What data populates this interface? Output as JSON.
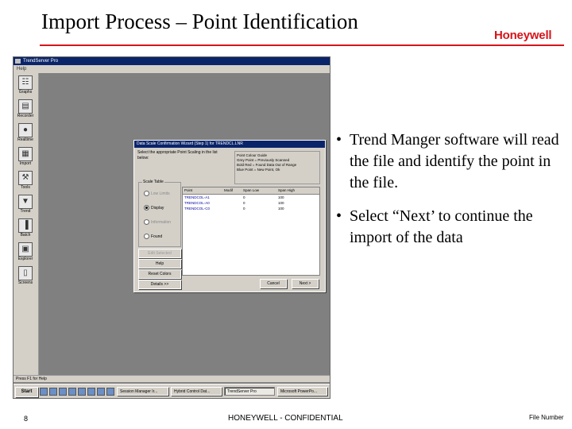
{
  "slide": {
    "title": "Import Process – Point Identification",
    "brand": "Honeywell",
    "page_number": "8",
    "confidential": "HONEYWELL - CONFIDENTIAL",
    "file_number": "File Number"
  },
  "bullets": [
    {
      "mark": "•",
      "text": "Trend Manger software will read the file and identify the point in the file."
    },
    {
      "mark": "•",
      "text": "Select “Next’ to continue the import of the data"
    }
  ],
  "app": {
    "window_title": "TrendServer Pro",
    "menu": "Help",
    "status_text": "Press F1 for Help",
    "sidebar": [
      {
        "label": "Graphs",
        "icon": "graphs-icon",
        "glyph": "☷"
      },
      {
        "label": "Recorder",
        "icon": "recorder-icon",
        "glyph": "▤"
      },
      {
        "label": "Realtime",
        "icon": "realtime-icon",
        "glyph": "●"
      },
      {
        "label": "Import",
        "icon": "import-icon",
        "glyph": "▦"
      },
      {
        "label": "Tools",
        "icon": "tools-icon",
        "glyph": "⚒"
      },
      {
        "label": "Trend",
        "icon": "trend-icon",
        "glyph": "▼"
      },
      {
        "label": "Batch",
        "icon": "batch-icon",
        "glyph": "▐"
      },
      {
        "label": "Explorer",
        "icon": "explorer-icon",
        "glyph": "▣"
      },
      {
        "label": "Screens",
        "icon": "screens-icon",
        "glyph": "▯"
      }
    ],
    "taskbar": {
      "start": "Start",
      "tasks": [
        "Session Manager Ir...",
        "Hybrid Control Dat...",
        "TrendServer Pro",
        "Microsoft PowerPo..."
      ],
      "active_index": 2
    }
  },
  "dialog": {
    "title": "Data Scale Confirmation Wizard (Step 1) for TRENDCL.LNR",
    "instructions": "Select the appropriate Point Scaling in the list below:",
    "legend_title": "Point Colour Guide",
    "legend_lines": [
      "Grey Point = Previously Scanned",
      "Bold Red = Found Data Out of Range",
      "Blue Point = New Point, Ok"
    ],
    "group_label": "Scale Table",
    "radios": [
      {
        "label": "Low Limits",
        "selected": false,
        "enabled": false
      },
      {
        "label": "Display",
        "selected": true,
        "enabled": true
      },
      {
        "label": "Information",
        "selected": false,
        "enabled": false
      },
      {
        "label": "Found",
        "selected": false,
        "enabled": true
      }
    ],
    "side_buttons": [
      {
        "label": "Edit Selected",
        "enabled": false
      },
      {
        "label": "Help",
        "enabled": true
      },
      {
        "label": "Reset Colors",
        "enabled": true
      },
      {
        "label": "Details >>",
        "enabled": true
      }
    ],
    "columns": [
      "Point",
      "Modif",
      "Span Low",
      "Span High"
    ],
    "rows": [
      [
        "TRENDCOL-A1",
        "",
        "0",
        "100"
      ],
      [
        "TRENDCOL-A0",
        "",
        "0",
        "100"
      ],
      [
        "TRENDCOL-C0",
        "",
        "0",
        "100"
      ]
    ],
    "cancel_label": "Cancel",
    "next_label": "Next >"
  }
}
